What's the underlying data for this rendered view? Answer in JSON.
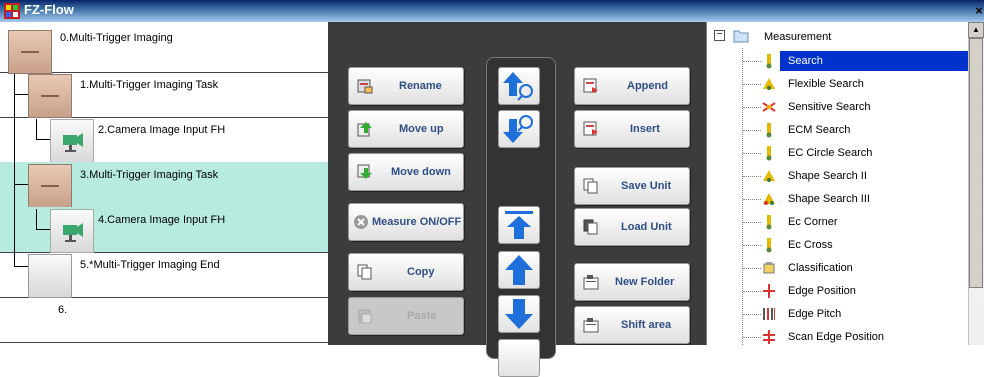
{
  "window": {
    "title": "FZ-Flow",
    "close_glyph": "×"
  },
  "flow": {
    "rows": [
      {
        "label": "0.Multi-Trigger Imaging"
      },
      {
        "label": "1.Multi-Trigger Imaging Task"
      },
      {
        "label": "2.Camera Image Input FH"
      },
      {
        "label": "3.Multi-Trigger Imaging Task"
      },
      {
        "label": "4.Camera Image Input FH"
      },
      {
        "label": "5.*Multi-Trigger Imaging End"
      },
      {
        "label": "6."
      }
    ]
  },
  "buttons": {
    "rename": "Rename",
    "move_up": "Move up",
    "move_down": "Move down",
    "measure": "Measure ON/OFF",
    "copy": "Copy",
    "paste": "Paste",
    "append": "Append",
    "insert": "Insert",
    "save_unit": "Save Unit",
    "load_unit": "Load Unit",
    "new_folder": "New Folder",
    "shift_area": "Shift area"
  },
  "tree": {
    "root": "Measurement",
    "items": [
      "Search",
      "Flexible Search",
      "Sensitive Search",
      "ECM Search",
      "EC Circle Search",
      "Shape Search II",
      "Shape Search III",
      "Ec Corner",
      "Ec Cross",
      "Classification",
      "Edge Position",
      "Edge Pitch",
      "Scan Edge Position"
    ]
  },
  "colors": {
    "selection": "#0033cc",
    "highlight_row": "#b7ebe0",
    "button_text": "#2e4e86"
  }
}
